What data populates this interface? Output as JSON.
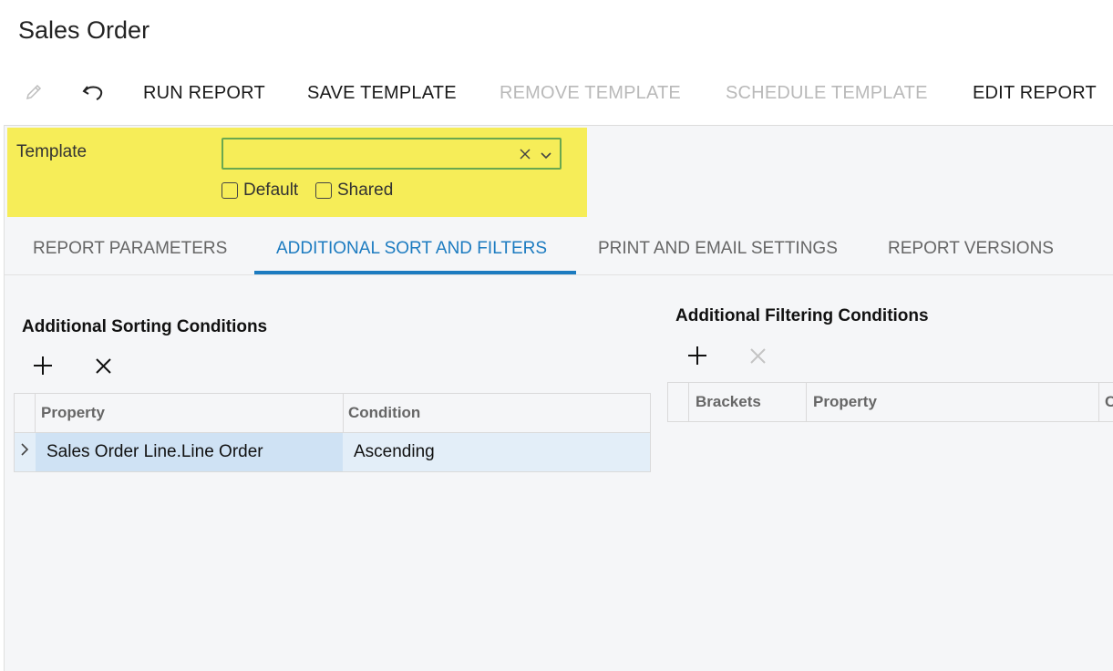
{
  "page": {
    "title": "Sales Order"
  },
  "toolbar": {
    "edit_icon": "pencil-icon",
    "undo_icon": "undo-icon",
    "run_report": "RUN REPORT",
    "save_template": "SAVE TEMPLATE",
    "remove_template": "REMOVE TEMPLATE",
    "schedule_template": "SCHEDULE TEMPLATE",
    "edit_report": "EDIT REPORT"
  },
  "template": {
    "label": "Template",
    "value": "",
    "default_label": "Default",
    "default_checked": false,
    "shared_label": "Shared",
    "shared_checked": false
  },
  "tabs": [
    {
      "label": "REPORT PARAMETERS",
      "active": false
    },
    {
      "label": "ADDITIONAL SORT AND FILTERS",
      "active": true
    },
    {
      "label": "PRINT AND EMAIL SETTINGS",
      "active": false
    },
    {
      "label": "REPORT VERSIONS",
      "active": false
    }
  ],
  "sorting": {
    "title": "Additional Sorting Conditions",
    "columns": [
      "Property",
      "Condition"
    ],
    "rows": [
      {
        "property": "Sales Order Line.Line Order",
        "condition": "Ascending"
      }
    ]
  },
  "filtering": {
    "title": "Additional Filtering Conditions",
    "columns": [
      "Brackets",
      "Property",
      "C"
    ]
  },
  "colors": {
    "accent": "#1c7bc0",
    "highlight": "#f6ed58",
    "selected_row": "#e3eef8",
    "selected_cell": "#cfe2f4"
  }
}
